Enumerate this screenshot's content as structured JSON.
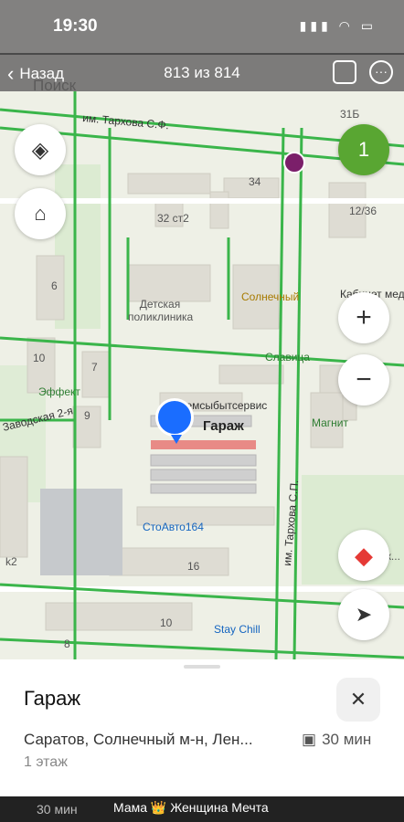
{
  "status_bar": {
    "time": "19:30"
  },
  "viewer": {
    "back_label": "Назад",
    "counter": "813 из 814"
  },
  "search": {
    "placeholder": "Поиск"
  },
  "map": {
    "street_labels": [
      "им. Тархова С.Ф.",
      "им. Тархова С.П.",
      "Заводская 2-я"
    ],
    "building_numbers": [
      "34",
      "32 ст2",
      "6",
      "10",
      "7",
      "9",
      "16",
      "10",
      "8",
      "12/36",
      "31Б",
      "k2"
    ],
    "poi_labels": [
      "Детская поликлиника",
      "Солнечный",
      "Славица",
      "Эффект",
      "Ремсыбытсервис",
      "Гараж",
      "Магнит",
      "СтоАвто164",
      "Stay Chill",
      "Кабинет мед...",
      "Парик..."
    ],
    "badge_count": "1",
    "zoom_in": "+",
    "zoom_out": "−",
    "compass_label": "N"
  },
  "place_card": {
    "title": "Гараж",
    "address": "Саратов, Солнечный м-н, Лен...",
    "travel_time": "30 мин",
    "floor": "1 этаж",
    "close_label": "✕"
  },
  "media_bar": {
    "song": "Мама 👑 Женщина Мечта",
    "left_time": "30 мин"
  },
  "colors": {
    "road_green": "#3ab54a",
    "pin_blue": "#1a6dff",
    "accent_green": "#59a632",
    "selected_red": "#e84a4a"
  }
}
